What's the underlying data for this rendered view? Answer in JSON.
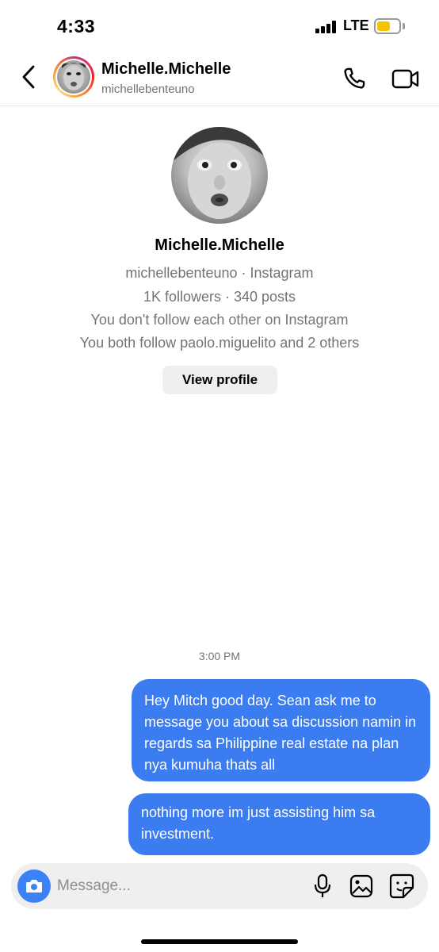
{
  "status_bar": {
    "time": "4:33",
    "network": "LTE",
    "battery_color": "#f5c400"
  },
  "header": {
    "name": "Michelle.Michelle",
    "username": "michellebenteuno",
    "icons": [
      "back-chevron-icon",
      "phone-icon",
      "video-camera-icon"
    ]
  },
  "profile": {
    "name": "Michelle.Michelle",
    "source": "michellebenteuno · Instagram",
    "stats": "1K followers · 340 posts",
    "follow_status": "You don't follow each other on Instagram",
    "mutuals": "You both follow paolo.miguelito and 2 others",
    "view_profile_label": "View profile"
  },
  "messages": {
    "timestamp": "3:00 PM",
    "items": [
      {
        "sender": "me",
        "text": "Hey Mitch good day. Sean ask me to message you about sa discussion namin in regards sa Philippine real estate na plan nya kumuha thats all"
      },
      {
        "sender": "me",
        "text": "nothing more im just assisting him sa investment."
      }
    ],
    "bubble_color": "#3b7cf0"
  },
  "composer": {
    "placeholder": "Message...",
    "icons": [
      "camera-icon",
      "microphone-icon",
      "gallery-icon",
      "sticker-icon"
    ],
    "camera_color": "#3b82f6"
  }
}
